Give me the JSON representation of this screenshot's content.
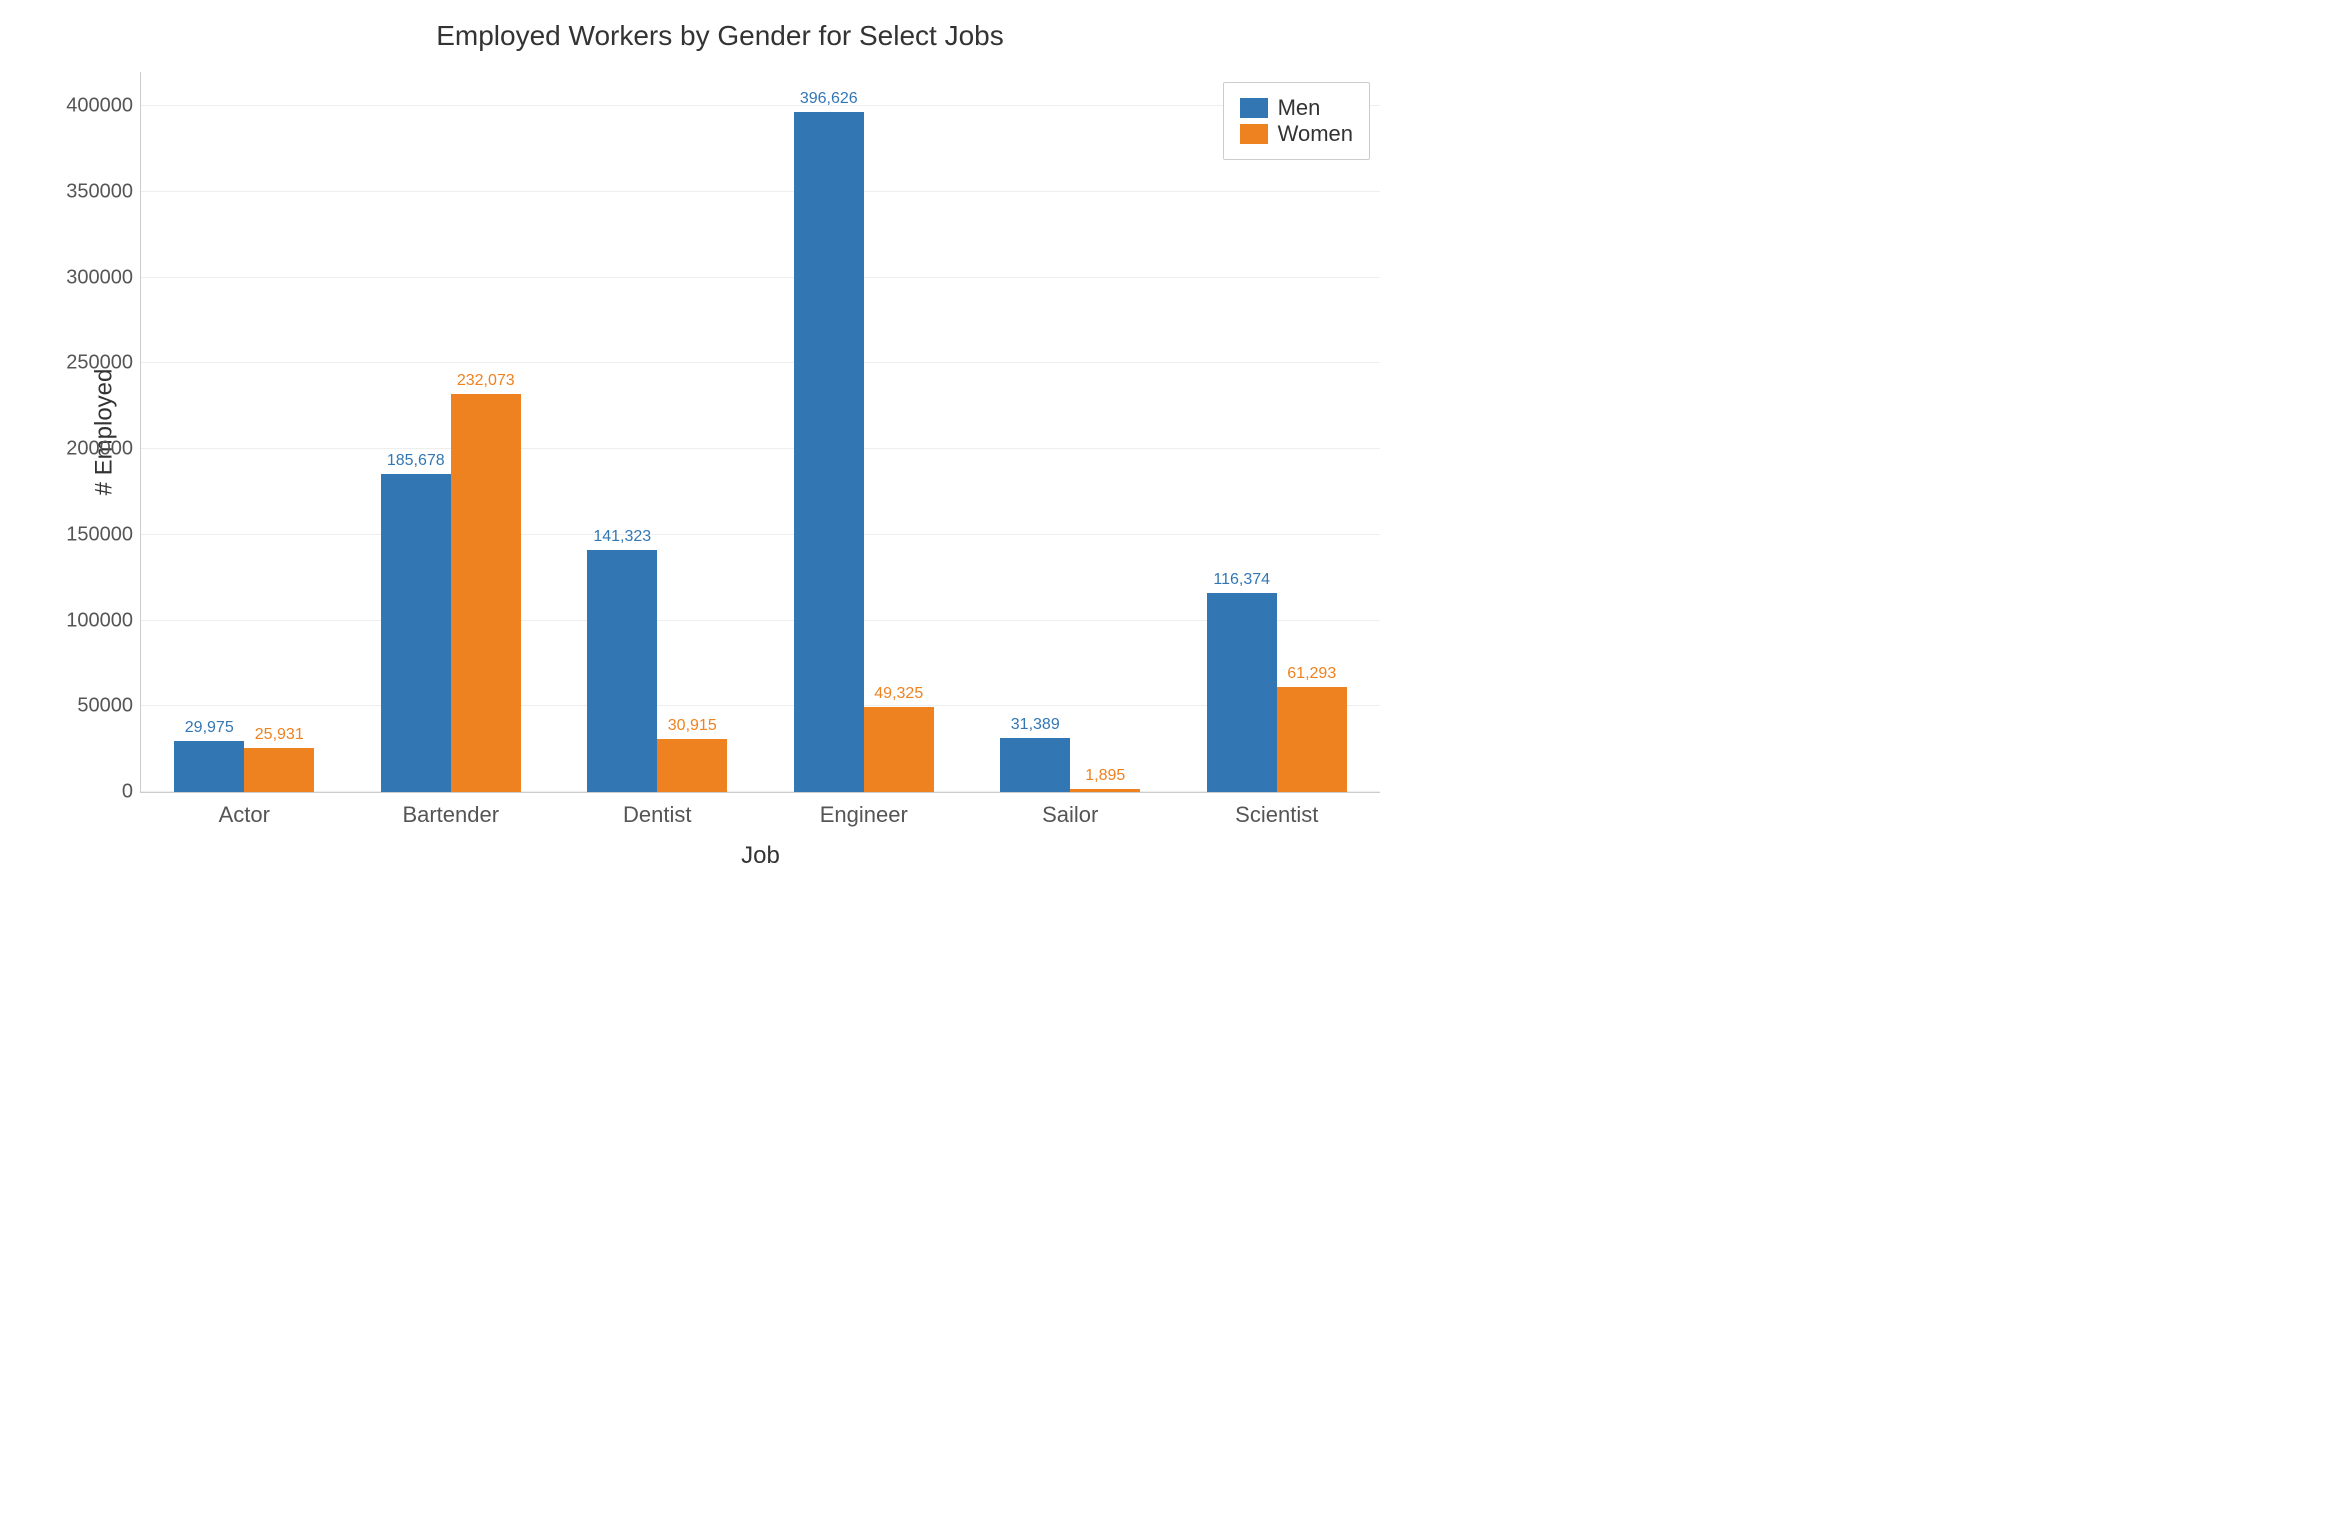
{
  "chart_data": {
    "type": "bar",
    "title": "Employed Workers by Gender for Select Jobs",
    "xlabel": "Job",
    "ylabel": "# Employed",
    "categories": [
      "Actor",
      "Bartender",
      "Dentist",
      "Engineer",
      "Sailor",
      "Scientist"
    ],
    "series": [
      {
        "name": "Men",
        "values": [
          29975,
          185678,
          141323,
          396626,
          31389,
          116374
        ],
        "color": "#3277b4"
      },
      {
        "name": "Women",
        "values": [
          25931,
          232073,
          30915,
          49325,
          1895,
          61293
        ],
        "color": "#ee8220"
      }
    ],
    "ylim": [
      0,
      420000
    ],
    "y_ticks": [
      0,
      50000,
      100000,
      150000,
      200000,
      250000,
      300000,
      350000,
      400000
    ],
    "y_tick_labels": [
      "0",
      "50000",
      "100000",
      "150000",
      "200000",
      "250000",
      "300000",
      "350000",
      "400000"
    ],
    "value_labels": [
      [
        "29,975",
        "185,678",
        "141,323",
        "396,626",
        "31,389",
        "116,374"
      ],
      [
        "25,931",
        "232,073",
        "30,915",
        "49,325",
        "1,895",
        "61,293"
      ]
    ],
    "legend_position": "upper-right"
  }
}
